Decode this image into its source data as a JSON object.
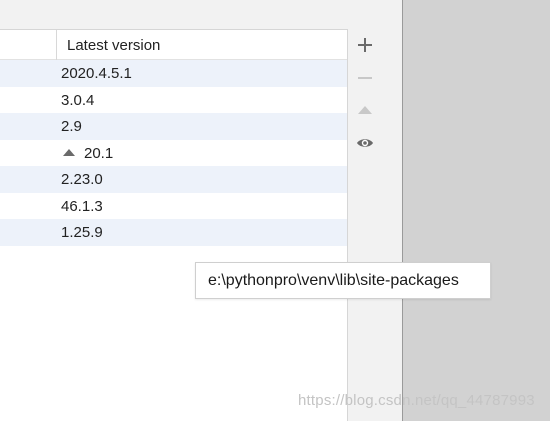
{
  "table": {
    "column_header": "Latest version",
    "rows": [
      {
        "latest": "2020.4.5.1",
        "upgrade": false
      },
      {
        "latest": "3.0.4",
        "upgrade": false
      },
      {
        "latest": "2.9",
        "upgrade": false
      },
      {
        "latest": "20.1",
        "upgrade": true
      },
      {
        "latest": "2.23.0",
        "upgrade": false
      },
      {
        "latest": "46.1.3",
        "upgrade": false
      },
      {
        "latest": "1.25.9",
        "upgrade": false
      }
    ]
  },
  "toolbar": {
    "buttons": [
      {
        "icon": "plus-icon",
        "enabled": true
      },
      {
        "icon": "minus-icon",
        "enabled": false
      },
      {
        "icon": "upgrade-arrow-icon",
        "enabled": false
      },
      {
        "icon": "eye-icon",
        "enabled": true
      }
    ]
  },
  "tooltip": {
    "text": "e:\\pythonpro\\venv\\lib\\site-packages"
  },
  "watermark": {
    "text": "https://blog.csdn.net/qq_44787993"
  },
  "colors": {
    "row_alt": "#edf2fa",
    "backdrop": "#d2d2d2",
    "icon_active": "#6a6a6a",
    "icon_disabled": "#c8c8c8"
  }
}
